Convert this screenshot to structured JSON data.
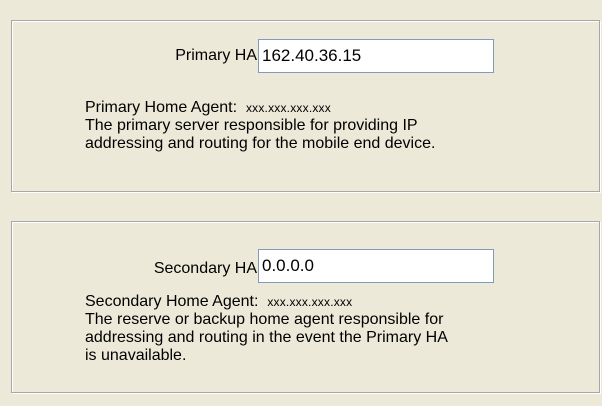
{
  "primary": {
    "label": "Primary HA",
    "value": "162.40.36.15",
    "heading": "Primary Home Agent:",
    "mask": "xxx.xxx.xxx.xxx",
    "description_lines": [
      "The primary server responsible for providing IP",
      "addressing and routing for the mobile end device."
    ]
  },
  "secondary": {
    "label": "Secondary HA",
    "value": "0.0.0.0",
    "heading": "Secondary Home Agent:",
    "mask": "xxx.xxx.xxx.xxx",
    "description_lines": [
      "The reserve or backup home agent responsible for",
      "addressing and routing in the event the Primary HA",
      "is unavailable."
    ]
  }
}
